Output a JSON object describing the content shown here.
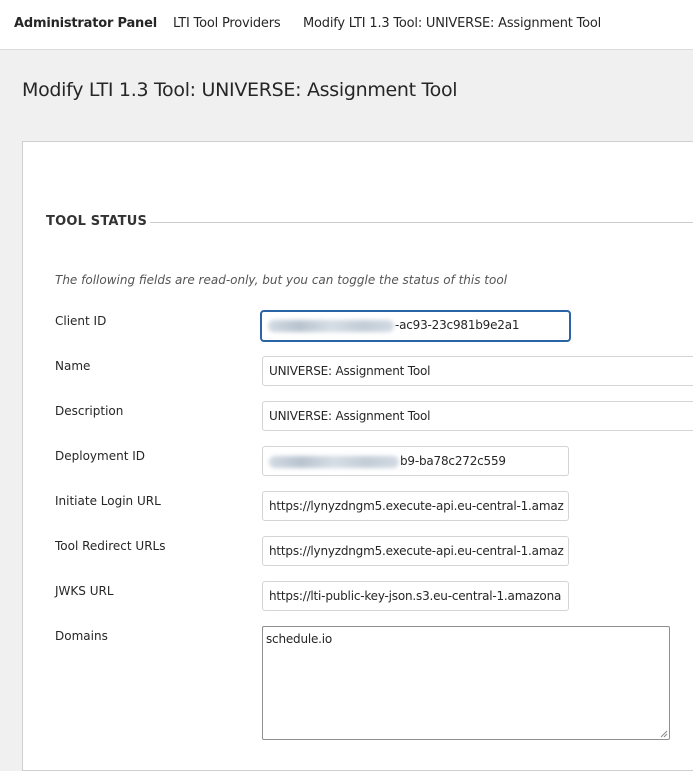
{
  "nav": {
    "brand": "Administrator Panel",
    "breadcrumb_1": "LTI Tool Providers",
    "breadcrumb_2": "Modify LTI 1.3 Tool: UNIVERSE: Assignment Tool"
  },
  "page_title": "Modify LTI 1.3 Tool: UNIVERSE: Assignment Tool",
  "section": {
    "heading": "TOOL STATUS",
    "hint": "The following fields are read-only, but you can toggle the status of this tool"
  },
  "fields": {
    "client_id": {
      "label": "Client ID",
      "value_visible": "-ac93-23c981b9e2a1"
    },
    "name": {
      "label": "Name",
      "value": "UNIVERSE: Assignment Tool"
    },
    "description": {
      "label": "Description",
      "value": "UNIVERSE: Assignment Tool"
    },
    "deployment_id": {
      "label": "Deployment ID",
      "value_visible": "b9-ba78c272c559"
    },
    "initiate_login_url": {
      "label": "Initiate Login URL",
      "value": "https://lynyzdngm5.execute-api.eu-central-1.amaz"
    },
    "tool_redirect_urls": {
      "label": "Tool Redirect URLs",
      "value": "https://lynyzdngm5.execute-api.eu-central-1.amaz"
    },
    "jwks_url": {
      "label": "JWKS URL",
      "value": "https://lti-public-key-json.s3.eu-central-1.amazona"
    },
    "domains": {
      "label": "Domains",
      "value": "schedule.io"
    }
  },
  "colors": {
    "page_background": "#f0f0f0",
    "focus_border": "#2a64a6",
    "text": "#262626"
  }
}
